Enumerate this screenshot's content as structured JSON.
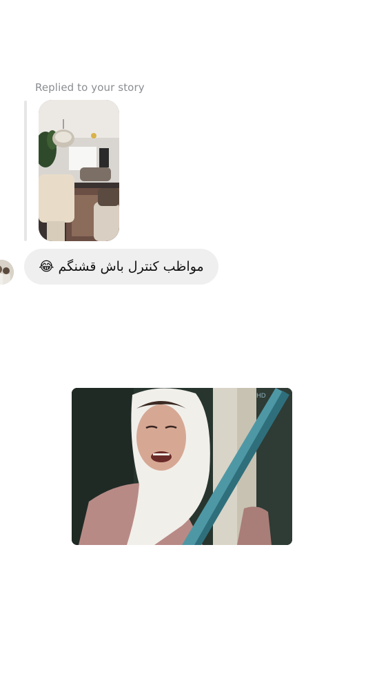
{
  "thread": {
    "reply_context": {
      "label": "Replied to your story",
      "story_thumbnail": "story-image-living-room"
    },
    "incoming_message": {
      "text": "مواظب کنترل باش قشنگم 😂",
      "avatar": "contact-avatar"
    },
    "outgoing_media": {
      "type": "image",
      "description_icon": "crying-woman-photo"
    }
  },
  "colors": {
    "background": "#ffffff",
    "bubble": "#efeff0",
    "label": "#8a8d91",
    "reply_bar": "#e6e6e6"
  }
}
